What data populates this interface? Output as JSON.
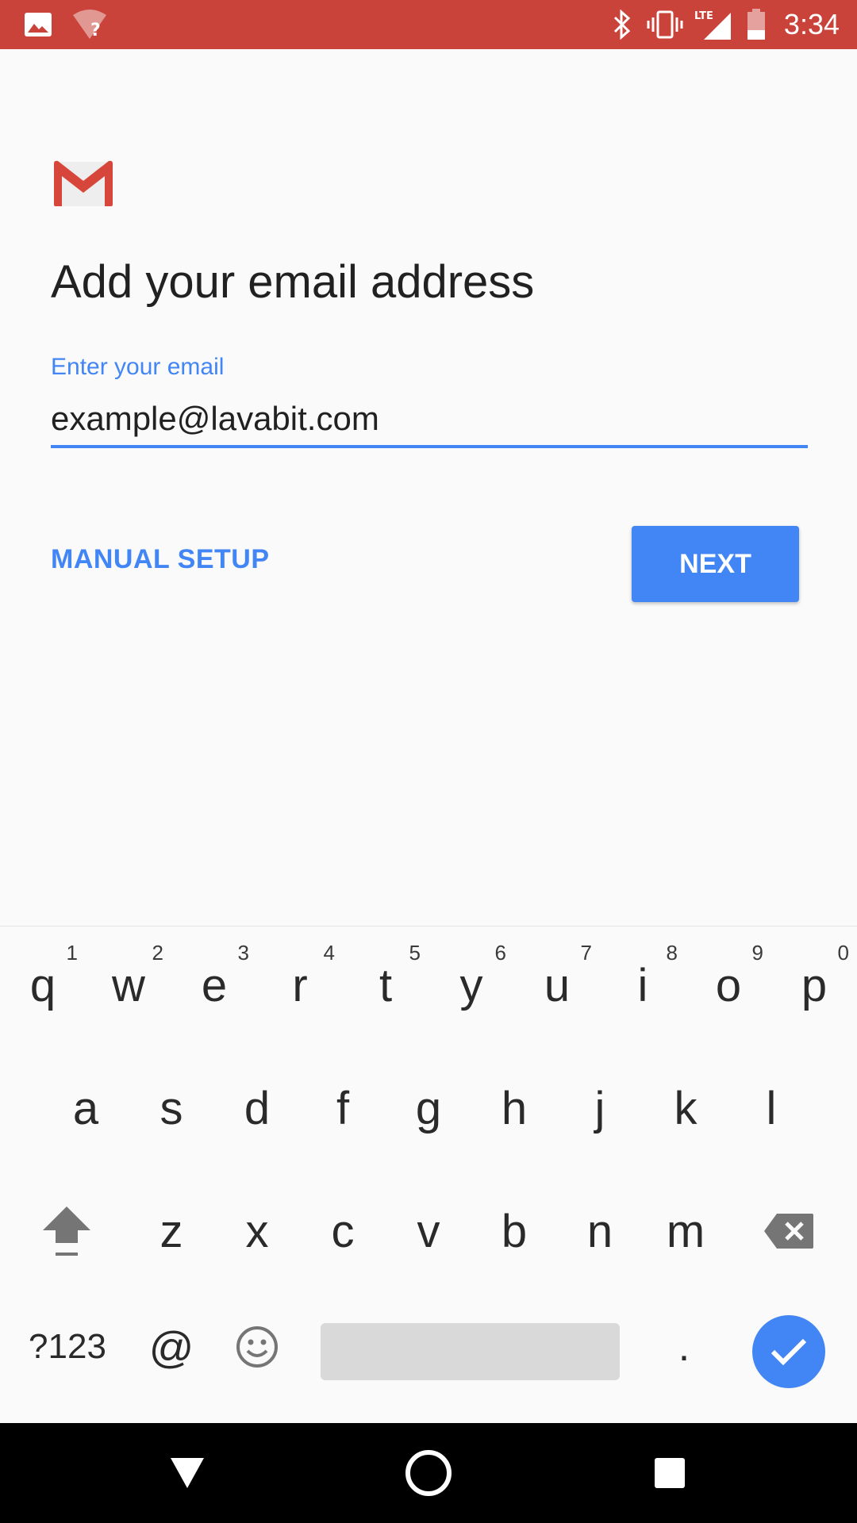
{
  "status_bar": {
    "time": "3:34",
    "icons": [
      "image-icon",
      "wifi-unknown-icon",
      "bluetooth-icon",
      "vibrate-icon",
      "lte-signal-icon",
      "battery-icon"
    ],
    "network_label": "LTE",
    "color": "#c9433a"
  },
  "main": {
    "logo": "gmail-logo",
    "title": "Add your email address",
    "email_field": {
      "label": "Enter your email",
      "value": "example@lavabit.com"
    },
    "manual_setup_label": "MANUAL SETUP",
    "next_label": "NEXT",
    "accent_color": "#4285f4"
  },
  "keyboard": {
    "row1": [
      {
        "key": "q",
        "hint": "1"
      },
      {
        "key": "w",
        "hint": "2"
      },
      {
        "key": "e",
        "hint": "3"
      },
      {
        "key": "r",
        "hint": "4"
      },
      {
        "key": "t",
        "hint": "5"
      },
      {
        "key": "y",
        "hint": "6"
      },
      {
        "key": "u",
        "hint": "7"
      },
      {
        "key": "i",
        "hint": "8"
      },
      {
        "key": "o",
        "hint": "9"
      },
      {
        "key": "p",
        "hint": "0"
      }
    ],
    "row2": [
      "a",
      "s",
      "d",
      "f",
      "g",
      "h",
      "j",
      "k",
      "l"
    ],
    "row3": [
      "z",
      "x",
      "c",
      "v",
      "b",
      "n",
      "m"
    ],
    "symbols_label": "?123",
    "at_label": "@",
    "period_label": ".",
    "icons": [
      "shift-icon",
      "backspace-icon",
      "emoji-icon",
      "check-icon"
    ]
  },
  "nav_bar": {
    "icons": [
      "back-icon",
      "home-icon",
      "recents-icon"
    ]
  }
}
